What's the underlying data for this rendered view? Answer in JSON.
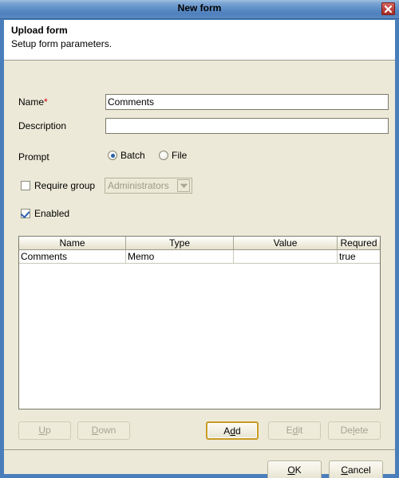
{
  "window": {
    "title": "New form",
    "close_icon": "close-icon"
  },
  "header": {
    "title": "Upload form",
    "subtitle": "Setup form parameters."
  },
  "form": {
    "name": {
      "label": "Name",
      "required_marker": "*",
      "value": "Comments",
      "placeholder": ""
    },
    "description": {
      "label": "Description",
      "value": "",
      "placeholder": ""
    },
    "prompt": {
      "label": "Prompt",
      "options": [
        "Batch",
        "File"
      ],
      "selected": "Batch"
    },
    "require_group": {
      "label": "Require group",
      "checked": false,
      "combo_value": "Administrators",
      "combo_enabled": false,
      "options": [
        "Administrators"
      ]
    },
    "enabled": {
      "label": "Enabled",
      "checked": true
    }
  },
  "table": {
    "columns": [
      "Name",
      "Type",
      "Value",
      "Requred"
    ],
    "rows": [
      [
        "Comments",
        "Memo",
        "",
        "true"
      ]
    ]
  },
  "list_buttons": {
    "up": {
      "label": "Up",
      "mnemonic_index": 0,
      "enabled": false
    },
    "down": {
      "label": "Down",
      "mnemonic_index": 0,
      "enabled": false
    },
    "add": {
      "label": "Add",
      "mnemonic_index": 1,
      "enabled": true,
      "focused": true
    },
    "edit": {
      "label": "Edit",
      "mnemonic_index": 1,
      "enabled": false
    },
    "delete": {
      "label": "Delete",
      "mnemonic_index": 2,
      "enabled": false
    }
  },
  "dialog_buttons": {
    "ok": {
      "label": "OK",
      "mnemonic_index": 0,
      "enabled": true
    },
    "cancel": {
      "label": "Cancel",
      "mnemonic_index": 0,
      "enabled": true
    }
  },
  "colors": {
    "titlebar_blue": "#5b8cc6",
    "dialog_face": "#ece9d8",
    "required_star": "#cc0000",
    "focus_border": "#c89a22",
    "radio_dot": "#2b5fa8",
    "close_red": "#c04840"
  }
}
